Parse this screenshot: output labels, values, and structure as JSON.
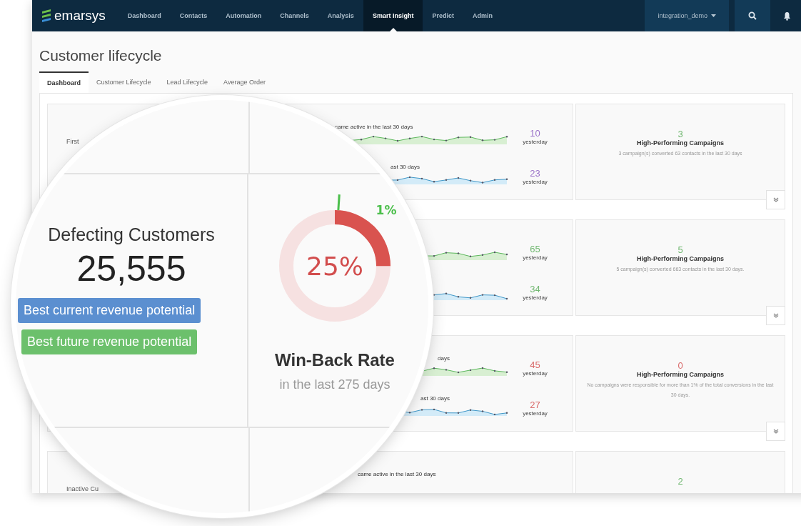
{
  "navbar": {
    "logo_text": "emarsys",
    "items": [
      {
        "label": "Dashboard",
        "selected": false
      },
      {
        "label": "Contacts",
        "selected": false
      },
      {
        "label": "Automation",
        "selected": false
      },
      {
        "label": "Channels",
        "selected": false
      },
      {
        "label": "Analysis",
        "selected": false
      },
      {
        "label": "Smart Insight",
        "selected": true
      },
      {
        "label": "Predict",
        "selected": false
      },
      {
        "label": "Admin",
        "selected": false
      }
    ],
    "user": "integration_demo"
  },
  "page_title": "Customer lifecycle",
  "tabs": [
    {
      "label": "Dashboard",
      "selected": true
    },
    {
      "label": "Customer Lifecycle",
      "selected": false
    },
    {
      "label": "Lead Lifecycle",
      "selected": false
    },
    {
      "label": "Average Order",
      "selected": false
    }
  ],
  "rows": [
    {
      "name": "First",
      "metrics": [
        {
          "title": "came active in the last 30 days",
          "value": "10",
          "note": "yesterday",
          "color": "#9b72c9"
        },
        {
          "title": "ast 30 days",
          "value": "23",
          "note": "yesterday",
          "color": "#9b72c9"
        }
      ],
      "campaigns": {
        "count": "3",
        "color": "#72b872",
        "title": "High-Performing Campaigns",
        "text": "3 campaign(s) converted 63 contacts in the last 30 days"
      }
    },
    {
      "metrics": [
        {
          "value": "65",
          "note": "yesterday",
          "color": "#72b872"
        },
        {
          "value": "34",
          "note": "yesterday",
          "color": "#72b872"
        }
      ],
      "campaigns": {
        "count": "5",
        "color": "#72b872",
        "title": "High-Performing Campaigns",
        "text": "5 campaign(s) converted 663 contacts in the last 30 days."
      }
    },
    {
      "metrics": [
        {
          "title": "days",
          "value": "45",
          "note": "yesterday",
          "color": "#d96a6a"
        },
        {
          "title": "ast 30 days",
          "value": "27",
          "note": "yesterday",
          "color": "#d96a6a"
        }
      ],
      "campaigns": {
        "count": "0",
        "color": "#d96a6a",
        "title": "High-Performing Campaigns",
        "text": "No campaigns were responsible for more than 1% of the total conversions in the last 30 days."
      }
    },
    {
      "name": "Inactive Cu",
      "metrics": [
        {
          "title": "came active in the last 30 days"
        }
      ],
      "campaigns": {
        "count": "2",
        "color": "#72b872"
      }
    }
  ],
  "lens": {
    "segment": {
      "title": "Defecting Customers",
      "count": "25,555",
      "badges": [
        {
          "label": "Best current revenue potential",
          "kind": "current"
        },
        {
          "label": "Best future revenue potential",
          "kind": "future"
        }
      ]
    },
    "win_back": {
      "label": "25%",
      "level": 0.25,
      "marker": {
        "label": "1%"
      },
      "title": "Win-Back Rate",
      "subtitle": "in the last 275 days"
    }
  }
}
